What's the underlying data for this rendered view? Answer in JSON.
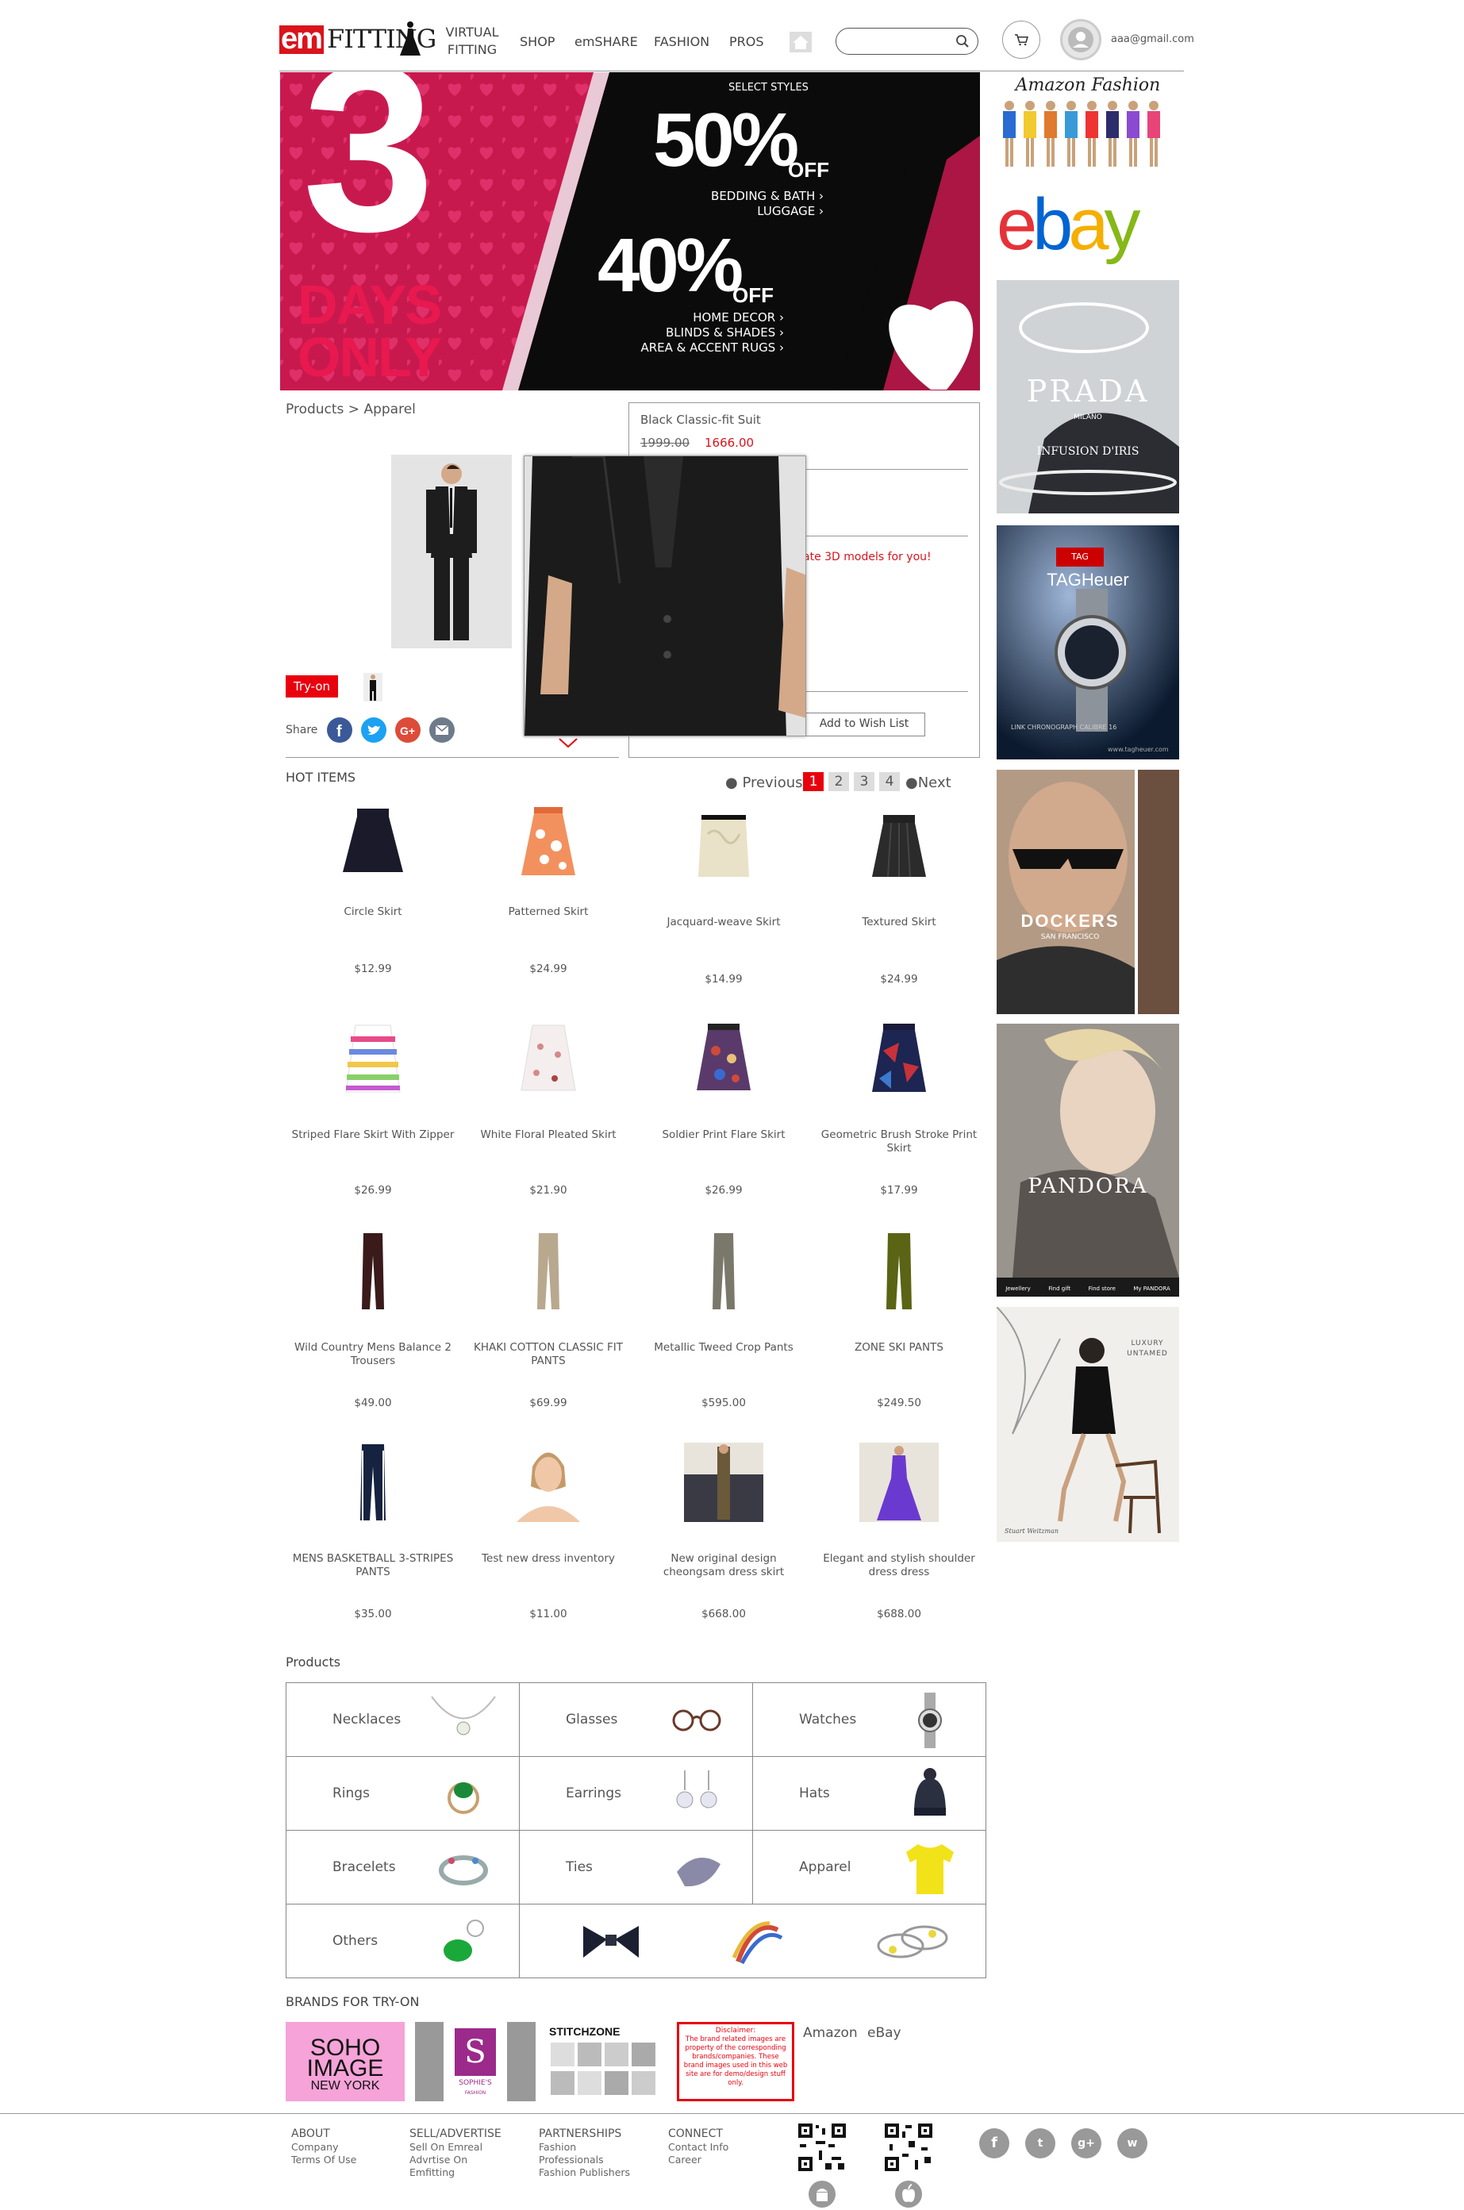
{
  "header": {
    "logo_em": "em",
    "logo_fitting": "FITTING",
    "nav": {
      "virtual_fitting": "VIRTUAL FITTING",
      "shop": "SHOP",
      "emshare": "emSHARE",
      "fashion": "FASHION",
      "pros": "PROS"
    },
    "search_placeholder": "",
    "user_email": "aaa@gmail.com"
  },
  "banner": {
    "big_number": "3",
    "days_only_line1": "DAYS",
    "days_only_line2": "ONLY",
    "select_styles": "SELECT STYLES",
    "offer1_pct": "50%",
    "offer1_off": "OFF",
    "offer1_cats": [
      "BEDDING & BATH ›",
      "LUGGAGE ›"
    ],
    "offer2_pct": "40%",
    "offer2_off": "OFF",
    "offer2_cats": [
      "HOME DECOR ›",
      "BLINDS & SHADES ›",
      "AREA & ACCENT RUGS ›"
    ]
  },
  "sidebar_ads": {
    "amazon_fashion": "Amazon Fashion",
    "ebay": "ebay",
    "prada": "PRADA",
    "prada_sub": "MILANO",
    "prada_sub2": "INFUSION D'IRIS",
    "tag_heuer": "TAGHeuer",
    "tag_caption": "LINK CHRONOGRAPH CALIBRE 16",
    "tag_url": "www.tagheuer.com",
    "dockers": "DOCKERS",
    "dockers_sub": "SAN FRANCISCO",
    "pandora": "PANDORA",
    "pandora_menu": [
      "Jewellery",
      "Find gift",
      "Find store",
      "My PANDORA"
    ],
    "luxury": "LUXURY UNTAMED",
    "luxury_brand": "Stuart Weitzman"
  },
  "breadcrumb": "Products > Apparel",
  "product": {
    "name": "Black Classic-fit Suit",
    "old_price": "1999.00",
    "new_price": "1666.00",
    "models_msg": "ate 3D models for you!",
    "wish_list": "Add to Wish List",
    "tryon": "Try-on",
    "share": "Share"
  },
  "hot_items": {
    "title": "HOT ITEMS",
    "previous": "Previous",
    "next": "Next",
    "pages": [
      "1",
      "2",
      "3",
      "4"
    ],
    "items": [
      {
        "name": "Circle Skirt",
        "price": "$12.99"
      },
      {
        "name": "Patterned Skirt",
        "price": "$24.99"
      },
      {
        "name": "Jacquard-weave Skirt",
        "price": "$14.99"
      },
      {
        "name": "Textured Skirt",
        "price": "$24.99"
      },
      {
        "name": "Striped Flare Skirt With Zipper",
        "price": "$26.99"
      },
      {
        "name": "White Floral Pleated Skirt",
        "price": "$21.90"
      },
      {
        "name": "Soldier Print Flare Skirt",
        "price": "$26.99"
      },
      {
        "name": "Geometric Brush Stroke Print Skirt",
        "price": "$17.99"
      },
      {
        "name": "Wild Country Mens Balance 2 Trousers",
        "price": "$49.00"
      },
      {
        "name": "KHAKI COTTON CLASSIC FIT PANTS",
        "price": "$69.99"
      },
      {
        "name": "Metallic Tweed Crop Pants",
        "price": "$595.00"
      },
      {
        "name": "ZONE SKI PANTS",
        "price": "$249.50"
      },
      {
        "name": "MENS BASKETBALL 3-STRIPES PANTS",
        "price": "$35.00"
      },
      {
        "name": "Test new dress inventory",
        "price": "$11.00"
      },
      {
        "name": "New original design cheongsam dress skirt",
        "price": "$668.00"
      },
      {
        "name": "Elegant and stylish shoulder dress dress",
        "price": "$688.00"
      }
    ]
  },
  "products": {
    "title": "Products",
    "categories": [
      "Necklaces",
      "Glasses",
      "Watches",
      "Rings",
      "Earrings",
      "Hats",
      "Bracelets",
      "Ties",
      "Apparel",
      "Others"
    ]
  },
  "brands": {
    "title": "BRANDS FOR TRY-ON",
    "soho": [
      "SOHO",
      "IMAGE",
      "NEW YORK"
    ],
    "sophies": "SOPHIE'S",
    "sophies_sub": "FASHION",
    "stitchzone": "STITCHZONE",
    "disclaimer_title": "Disclaimer:",
    "disclaimer": "The brand related images are property of the corresponding brands/companies. These brand images used in this web site are for demo/design stuff only.",
    "amazon": "Amazon",
    "ebay": "eBay"
  },
  "footer": {
    "about": {
      "title": "ABOUT",
      "links": [
        "Company",
        "Terms Of Use"
      ]
    },
    "sell": {
      "title": "SELL/ADVERTISE",
      "links": [
        "Sell On Emreal",
        "Advrtise On",
        "Emfitting"
      ]
    },
    "partnerships": {
      "title": "PARTNERSHIPS",
      "links": [
        "Fashion",
        "Professionals",
        "Fashion Publishers"
      ]
    },
    "connect": {
      "title": "CONNECT",
      "links": [
        "Contact Info",
        "Career"
      ]
    },
    "social": [
      "f",
      "t",
      "g+",
      "w"
    ]
  },
  "colors": {
    "accent_red": "#e8000d",
    "text": "#444444",
    "border": "#888888"
  }
}
